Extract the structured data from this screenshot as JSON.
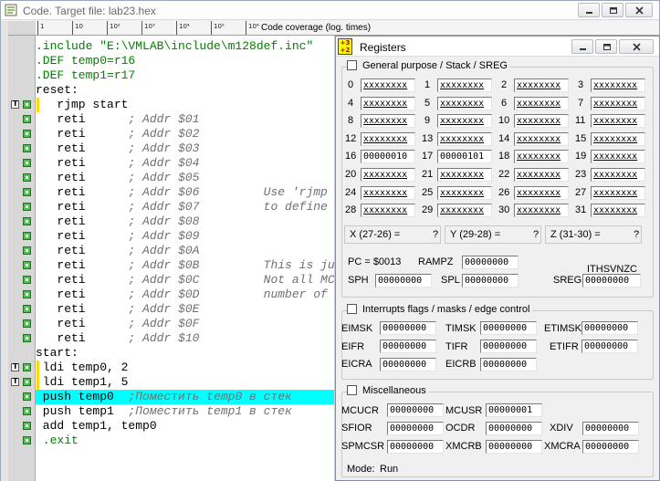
{
  "code_window": {
    "title": "Code. Target file: lab23.hex",
    "coverage_label": "Code coverage (log. times)",
    "ruler_labels": [
      "1",
      "10",
      "10²",
      "10³",
      "10⁴",
      "10⁵",
      "10⁶"
    ]
  },
  "code_lines": [
    {
      "parts": [
        {
          "t": ".include \"E:\\VMLAB\\include\\m128def.inc\"",
          "c": "kw"
        }
      ]
    },
    {
      "parts": [
        {
          "t": ".DEF temp0=r16",
          "c": "kw"
        }
      ]
    },
    {
      "parts": [
        {
          "t": ".DEF temp1=r17",
          "c": "kw"
        }
      ]
    },
    {
      "parts": [
        {
          "t": "reset:",
          "c": "lbl"
        }
      ]
    },
    {
      "parts": [
        {
          "t": "   rjmp start",
          "c": "plain"
        }
      ]
    },
    {
      "parts": [
        {
          "t": "   reti      ",
          "c": "plain"
        },
        {
          "t": "; Addr $01",
          "c": "com"
        }
      ]
    },
    {
      "parts": [
        {
          "t": "   reti      ",
          "c": "plain"
        },
        {
          "t": "; Addr $02",
          "c": "com"
        }
      ]
    },
    {
      "parts": [
        {
          "t": "   reti      ",
          "c": "plain"
        },
        {
          "t": "; Addr $03",
          "c": "com"
        }
      ]
    },
    {
      "parts": [
        {
          "t": "   reti      ",
          "c": "plain"
        },
        {
          "t": "; Addr $04",
          "c": "com"
        }
      ]
    },
    {
      "parts": [
        {
          "t": "   reti      ",
          "c": "plain"
        },
        {
          "t": "; Addr $05",
          "c": "com"
        }
      ]
    },
    {
      "parts": [
        {
          "t": "   reti      ",
          "c": "plain"
        },
        {
          "t": "; Addr $06         Use 'rjmp",
          "c": "com"
        }
      ]
    },
    {
      "parts": [
        {
          "t": "   reti      ",
          "c": "plain"
        },
        {
          "t": "; Addr $07         to define",
          "c": "com"
        }
      ]
    },
    {
      "parts": [
        {
          "t": "   reti      ",
          "c": "plain"
        },
        {
          "t": "; Addr $08",
          "c": "com"
        }
      ]
    },
    {
      "parts": [
        {
          "t": "   reti      ",
          "c": "plain"
        },
        {
          "t": "; Addr $09",
          "c": "com"
        }
      ]
    },
    {
      "parts": [
        {
          "t": "   reti      ",
          "c": "plain"
        },
        {
          "t": "; Addr $0A",
          "c": "com"
        }
      ]
    },
    {
      "parts": [
        {
          "t": "   reti      ",
          "c": "plain"
        },
        {
          "t": "; Addr $0B         This is ju",
          "c": "com"
        }
      ]
    },
    {
      "parts": [
        {
          "t": "   reti      ",
          "c": "plain"
        },
        {
          "t": "; Addr $0C         Not all MC",
          "c": "com"
        }
      ]
    },
    {
      "parts": [
        {
          "t": "   reti      ",
          "c": "plain"
        },
        {
          "t": "; Addr $0D         number of",
          "c": "com"
        }
      ]
    },
    {
      "parts": [
        {
          "t": "   reti      ",
          "c": "plain"
        },
        {
          "t": "; Addr $0E",
          "c": "com"
        }
      ]
    },
    {
      "parts": [
        {
          "t": "   reti      ",
          "c": "plain"
        },
        {
          "t": "; Addr $0F",
          "c": "com"
        }
      ]
    },
    {
      "parts": [
        {
          "t": "   reti      ",
          "c": "plain"
        },
        {
          "t": "; Addr $10",
          "c": "com"
        }
      ]
    },
    {
      "parts": [
        {
          "t": "start:",
          "c": "lbl"
        }
      ]
    },
    {
      "parts": [
        {
          "t": " ldi temp0, 2",
          "c": "plain"
        }
      ]
    },
    {
      "parts": [
        {
          "t": " ldi temp1, 5",
          "c": "plain"
        }
      ]
    },
    {
      "parts": [
        {
          "t": " push temp0  ",
          "c": "plain"
        },
        {
          "t": ";Поместить temp0 в стек",
          "c": "com"
        }
      ]
    },
    {
      "parts": [
        {
          "t": " push temp1  ",
          "c": "plain"
        },
        {
          "t": ";Поместить temp1 в стек",
          "c": "com"
        }
      ]
    },
    {
      "parts": [
        {
          "t": " add temp1, temp0",
          "c": "plain"
        }
      ]
    },
    {
      "parts": [
        {
          "t": " .exit",
          "c": "kw"
        }
      ]
    }
  ],
  "gutter_marks": [
    {
      "line": 4,
      "t": true,
      "g": true,
      "bar": true
    },
    {
      "line": 5,
      "t": false,
      "g": true
    },
    {
      "line": 6,
      "t": false,
      "g": true
    },
    {
      "line": 7,
      "t": false,
      "g": true
    },
    {
      "line": 8,
      "t": false,
      "g": true
    },
    {
      "line": 9,
      "t": false,
      "g": true
    },
    {
      "line": 10,
      "t": false,
      "g": true
    },
    {
      "line": 11,
      "t": false,
      "g": true
    },
    {
      "line": 12,
      "t": false,
      "g": true
    },
    {
      "line": 13,
      "t": false,
      "g": true
    },
    {
      "line": 14,
      "t": false,
      "g": true
    },
    {
      "line": 15,
      "t": false,
      "g": true
    },
    {
      "line": 16,
      "t": false,
      "g": true
    },
    {
      "line": 17,
      "t": false,
      "g": true
    },
    {
      "line": 18,
      "t": false,
      "g": true
    },
    {
      "line": 19,
      "t": false,
      "g": true
    },
    {
      "line": 20,
      "t": false,
      "g": true
    },
    {
      "line": 22,
      "t": true,
      "g": true,
      "bar": true
    },
    {
      "line": 23,
      "t": true,
      "g": true,
      "bar": true
    },
    {
      "line": 24,
      "t": false,
      "g": true
    },
    {
      "line": 25,
      "t": false,
      "g": true
    },
    {
      "line": 26,
      "t": false,
      "g": true
    },
    {
      "line": 27,
      "t": false,
      "g": true
    }
  ],
  "highlight_line": 24,
  "registers_window": {
    "title": "Registers",
    "icon_text": "+3\n+2",
    "general_title": "General purpose / Stack / SREG",
    "registers": [
      {
        "n": "0",
        "v": "xxxxxxxx"
      },
      {
        "n": "1",
        "v": "xxxxxxxx"
      },
      {
        "n": "2",
        "v": "xxxxxxxx"
      },
      {
        "n": "3",
        "v": "xxxxxxxx"
      },
      {
        "n": "4",
        "v": "xxxxxxxx"
      },
      {
        "n": "5",
        "v": "xxxxxxxx"
      },
      {
        "n": "6",
        "v": "xxxxxxxx"
      },
      {
        "n": "7",
        "v": "xxxxxxxx"
      },
      {
        "n": "8",
        "v": "xxxxxxxx"
      },
      {
        "n": "9",
        "v": "xxxxxxxx"
      },
      {
        "n": "10",
        "v": "xxxxxxxx"
      },
      {
        "n": "11",
        "v": "xxxxxxxx"
      },
      {
        "n": "12",
        "v": "xxxxxxxx"
      },
      {
        "n": "13",
        "v": "xxxxxxxx"
      },
      {
        "n": "14",
        "v": "xxxxxxxx"
      },
      {
        "n": "15",
        "v": "xxxxxxxx"
      },
      {
        "n": "16",
        "v": "00000010"
      },
      {
        "n": "17",
        "v": "00000101"
      },
      {
        "n": "18",
        "v": "xxxxxxxx"
      },
      {
        "n": "19",
        "v": "xxxxxxxx"
      },
      {
        "n": "20",
        "v": "xxxxxxxx"
      },
      {
        "n": "21",
        "v": "xxxxxxxx"
      },
      {
        "n": "22",
        "v": "xxxxxxxx"
      },
      {
        "n": "23",
        "v": "xxxxxxxx"
      },
      {
        "n": "24",
        "v": "xxxxxxxx"
      },
      {
        "n": "25",
        "v": "xxxxxxxx"
      },
      {
        "n": "26",
        "v": "xxxxxxxx"
      },
      {
        "n": "27",
        "v": "xxxxxxxx"
      },
      {
        "n": "28",
        "v": "xxxxxxxx"
      },
      {
        "n": "29",
        "v": "xxxxxxxx"
      },
      {
        "n": "30",
        "v": "xxxxxxxx"
      },
      {
        "n": "31",
        "v": "xxxxxxxx"
      }
    ],
    "pointers": [
      {
        "label": "X (27-26) =",
        "value": "?"
      },
      {
        "label": "Y (29-28) =",
        "value": "?"
      },
      {
        "label": "Z (31-30) =",
        "value": "?"
      }
    ],
    "pc_label": "PC = $0013",
    "rampz_label": "RAMPZ",
    "rampz_value": "00000000",
    "sph_label": "SPH",
    "sph_value": "00000000",
    "spl_label": "SPL",
    "spl_value": "00000000",
    "sreg_flags": "ITHSVNZC",
    "sreg_label": "SREG",
    "sreg_value": "00000000",
    "interrupts_title": "Interrupts flags / masks / edge control",
    "interrupts": [
      {
        "label": "EIMSK",
        "value": "00000000"
      },
      {
        "label": "TIMSK",
        "value": "00000000"
      },
      {
        "label": "ETIMSK",
        "value": "00000000"
      },
      {
        "label": "EIFR",
        "value": "00000000"
      },
      {
        "label": "TIFR",
        "value": "00000000"
      },
      {
        "label": "ETIFR",
        "value": "00000000"
      },
      {
        "label": "EICRA",
        "value": "00000000"
      },
      {
        "label": "EICRB",
        "value": "00000000"
      }
    ],
    "misc_title": "Miscellaneous",
    "misc": [
      {
        "label": "MCUCR",
        "value": "00000000"
      },
      {
        "label": "MCUSR",
        "value": "00000001"
      },
      {
        "label": "SFIOR",
        "value": "00000000"
      },
      {
        "label": "OCDR",
        "value": "00000000"
      },
      {
        "label": "XDIV",
        "value": "00000000"
      },
      {
        "label": "SPMCSR",
        "value": "00000000"
      },
      {
        "label": "XMCRB",
        "value": "00000000"
      },
      {
        "label": "XMCRA",
        "value": "00000000"
      }
    ],
    "mode_label": "Mode:",
    "mode_value": "Run"
  }
}
